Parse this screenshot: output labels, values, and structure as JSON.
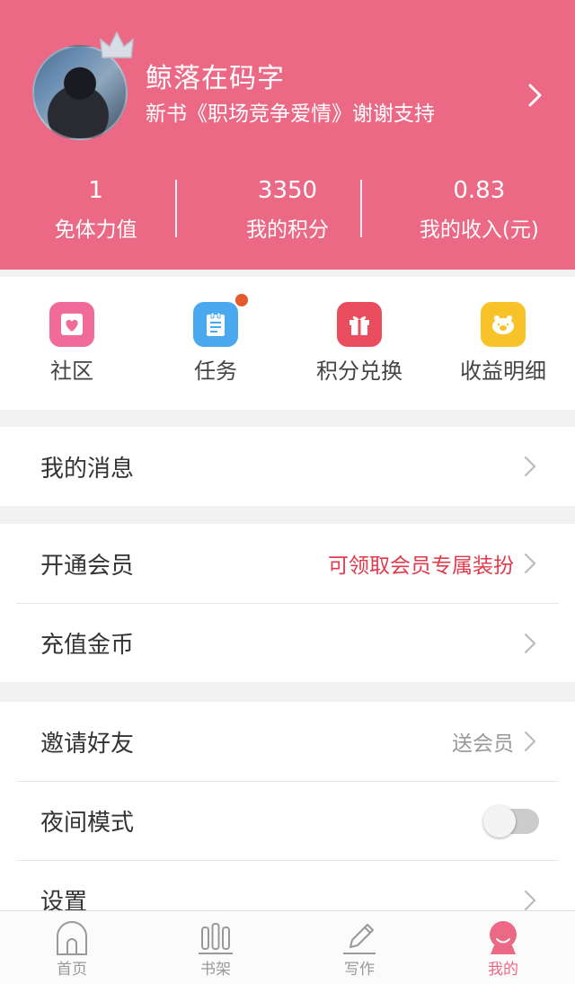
{
  "profile": {
    "name": "鲸落在码字",
    "subtitle": "新书《职场竞争爱情》谢谢支持",
    "avatar_icon": "avatar-photo",
    "crown_icon": "crown-icon"
  },
  "stats": [
    {
      "value": "1",
      "label": "免体力值"
    },
    {
      "value": "3350",
      "label": "我的积分"
    },
    {
      "value": "0.83",
      "label": "我的收入(元)"
    }
  ],
  "quick_actions": [
    {
      "label": "社区",
      "icon": "community-icon",
      "color": "#f06a9a"
    },
    {
      "label": "任务",
      "icon": "task-icon",
      "color": "#4aa9ee"
    },
    {
      "label": "积分兑换",
      "icon": "gift-icon",
      "color": "#ea4e5e"
    },
    {
      "label": "收益明细",
      "icon": "piggy-icon",
      "color": "#f7c328"
    }
  ],
  "menu": {
    "messages": {
      "label": "我的消息"
    },
    "vip": {
      "label": "开通会员",
      "value": "可领取会员专属装扮",
      "value_color": "#e03a4b"
    },
    "recharge": {
      "label": "充值金币"
    },
    "invite": {
      "label": "邀请好友",
      "value": "送会员"
    },
    "night_mode": {
      "label": "夜间模式",
      "enabled": false
    },
    "settings": {
      "label": "设置"
    }
  },
  "tabbar": {
    "items": [
      {
        "label": "首页",
        "icon": "home-icon"
      },
      {
        "label": "书架",
        "icon": "bookshelf-icon"
      },
      {
        "label": "写作",
        "icon": "pen-icon"
      },
      {
        "label": "我的",
        "icon": "profile-icon",
        "active": true
      }
    ]
  },
  "colors": {
    "brand": "#ec6986",
    "background": "#f2f2f2"
  }
}
